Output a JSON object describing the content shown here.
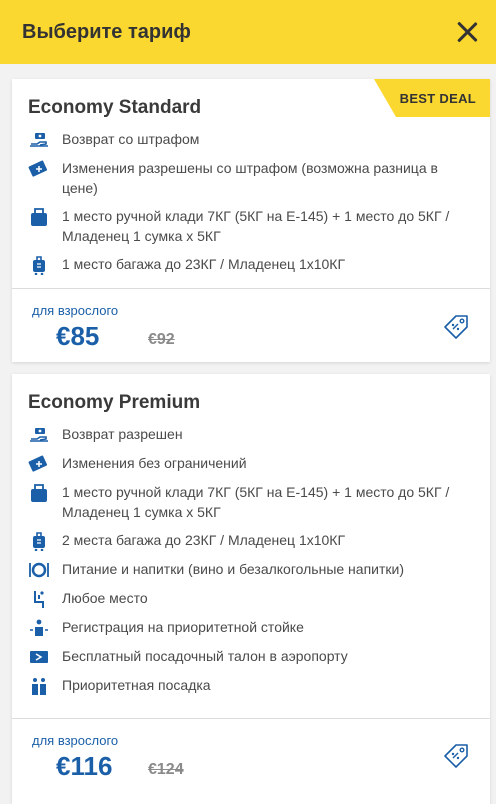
{
  "header": {
    "title": "Выберите тариф"
  },
  "fares": [
    {
      "name": "Economy Standard",
      "badge": "BEST DEAL",
      "features": [
        {
          "icon": "refund-icon",
          "text": "Возврат со штрафом"
        },
        {
          "icon": "ticket-change-icon",
          "text": "Изменения разрешены со штрафом (возможна разница в цене)"
        },
        {
          "icon": "hand-baggage-icon",
          "text": "1 место ручной клади 7КГ (5КГ на E-145) + 1 место до 5КГ / Младенец 1 сумка x 5КГ"
        },
        {
          "icon": "checked-baggage-icon",
          "text": "1 место багажа до 23КГ / Младенец 1x10КГ"
        }
      ],
      "price_label": "для взрослого",
      "price": "€85",
      "old_price": "€92"
    },
    {
      "name": "Economy Premium",
      "features": [
        {
          "icon": "refund-icon",
          "text": "Возврат разрешен"
        },
        {
          "icon": "ticket-change-icon",
          "text": "Изменения без ограничений"
        },
        {
          "icon": "hand-baggage-icon",
          "text": "1 место ручной клади 7КГ (5КГ на E-145) + 1 место до 5КГ / Младенец 1 сумка x 5КГ"
        },
        {
          "icon": "checked-baggage-icon",
          "text": "2 места багажа до 23КГ / Младенец 1x10КГ"
        },
        {
          "icon": "meal-icon",
          "text": "Питание и напитки (вино и безалкогольные напитки)"
        },
        {
          "icon": "seat-icon",
          "text": "Любое место"
        },
        {
          "icon": "priority-checkin-icon",
          "text": "Регистрация на приоритетной стойке"
        },
        {
          "icon": "boarding-pass-icon",
          "text": "Бесплатный посадочный талон в аэропорту"
        },
        {
          "icon": "priority-boarding-icon",
          "text": "Приоритетная посадка"
        }
      ],
      "price_label": "для взрослого",
      "price": "€116",
      "old_price": "€124"
    }
  ],
  "colors": {
    "accent": "#fbd830",
    "price": "#1a5fa8",
    "icon": "#1a5fa8"
  }
}
